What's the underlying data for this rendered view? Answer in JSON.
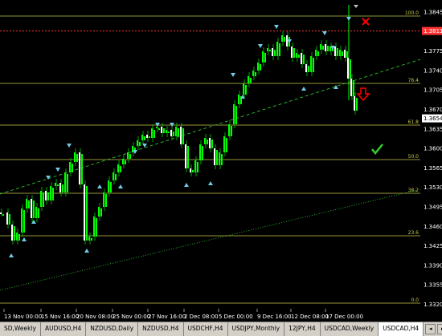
{
  "colors": {
    "background": "#000000",
    "bull_candle": "#00ff00",
    "bear_candle": "#ffffff",
    "fib_line": "#c8c84a",
    "trend_line": "#2fbf2f",
    "fractal_arrow": "#6ecbe6",
    "current_price_box": "#ffffff",
    "resistance_line": "#ff3333",
    "sell_arrow": "#ff0000",
    "check_mark": "#33cc33"
  },
  "icons": {
    "top_marker": "triangle-down-icon",
    "sell_arrow": "down-arrow-icon",
    "close_mark": "x-icon",
    "check_mark": "check-icon"
  },
  "price_axis": {
    "labels": [
      "1.3845",
      "1.3810",
      "1.3775",
      "1.3740",
      "1.3705",
      "1.3670",
      "1.3635",
      "1.3600",
      "1.3565",
      "1.3530",
      "1.3495",
      "1.3460",
      "1.3425",
      "1.3390",
      "1.3355",
      "1.3320",
      "1.3285"
    ],
    "current_price": "1.3654",
    "resistance_price": "1.3811"
  },
  "time_axis": {
    "labels": [
      "13 Nov 00:00",
      "15 Nov 16:00",
      "20 Nov 08:00",
      "25 Nov 00:00",
      "27 Nov 16:00",
      "2 Dec 08:00",
      "5 Dec 00:00",
      "9 Dec 16:00",
      "12 Dec 08:00",
      "17 Dec 00:00"
    ]
  },
  "fib_levels": [
    "100.0",
    "76.4",
    "61.8",
    "50.0",
    "38.2",
    "23.6",
    "0.0"
  ],
  "tabs": [
    {
      "label": "SD,Weekly",
      "active": false
    },
    {
      "label": "AUDUSD,H4",
      "active": false
    },
    {
      "label": "NZDUSD,Daily",
      "active": false
    },
    {
      "label": "NZDUSD,H4",
      "active": false
    },
    {
      "label": "USDCHF,H4",
      "active": false
    },
    {
      "label": "USDJPY,Monthly",
      "active": false
    },
    {
      "label": "12JPY,H4",
      "active": false
    },
    {
      "label": "USDCAD,Weekly",
      "active": false
    },
    {
      "label": "USDCAD,H4",
      "active": true
    }
  ]
}
